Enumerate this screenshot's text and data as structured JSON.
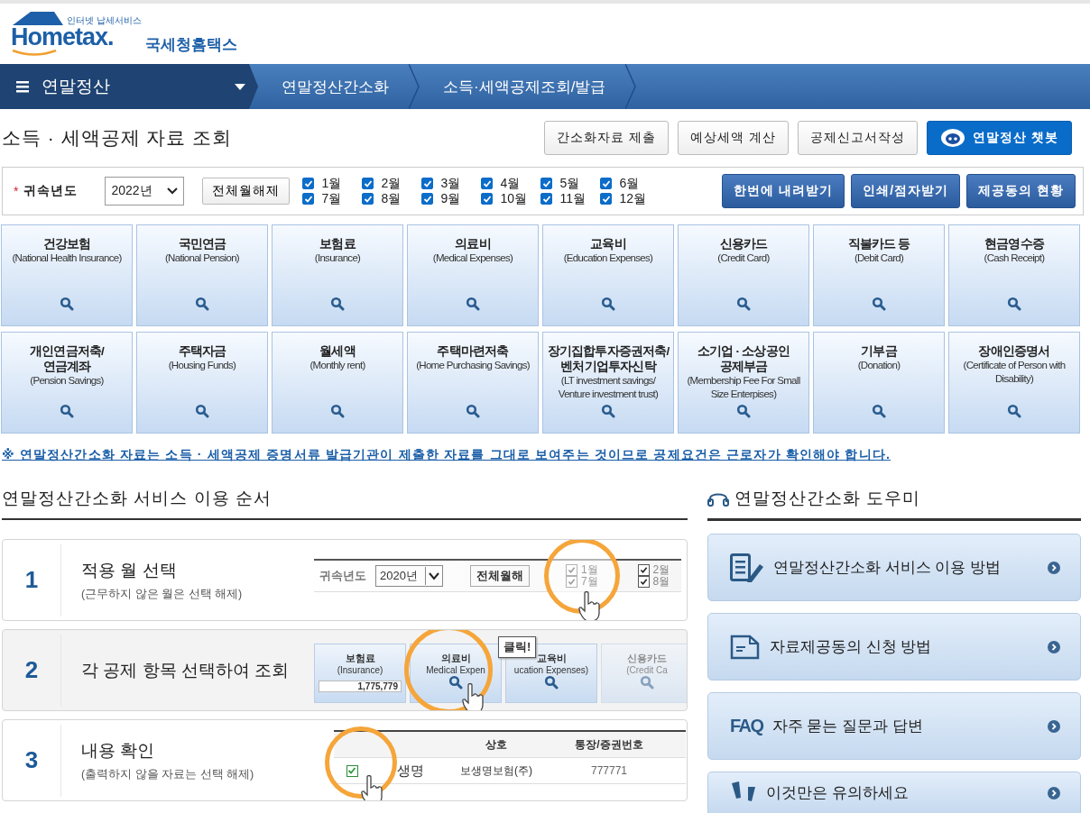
{
  "header": {
    "logo_tagline": "인터넷 납세서비스",
    "logo_word": "Hometax.",
    "logo_name": "국세청홈택스"
  },
  "nav": {
    "menu": "연말정산",
    "breadcrumbs": [
      "연말정산간소화",
      "소득·세액공제조회/발급"
    ]
  },
  "page_title": "소득 · 세액공제 자료 조회",
  "actions": [
    {
      "label": "간소화자료 제출",
      "kind": "plain"
    },
    {
      "label": "예상세액 계산",
      "kind": "plain"
    },
    {
      "label": "공제신고서작성",
      "kind": "plain"
    },
    {
      "label": "연말정산 챗봇",
      "kind": "chatbot"
    }
  ],
  "filter": {
    "required_mark": "*",
    "label": "귀속년도",
    "year": "2022년",
    "clear_button": "전체월해제",
    "months": [
      {
        "label": "1월",
        "checked": true
      },
      {
        "label": "2월",
        "checked": true
      },
      {
        "label": "3월",
        "checked": true
      },
      {
        "label": "4월",
        "checked": true
      },
      {
        "label": "5월",
        "checked": true
      },
      {
        "label": "6월",
        "checked": true
      },
      {
        "label": "7월",
        "checked": true
      },
      {
        "label": "8월",
        "checked": true
      },
      {
        "label": "9월",
        "checked": true
      },
      {
        "label": "10월",
        "checked": true
      },
      {
        "label": "11월",
        "checked": true
      },
      {
        "label": "12월",
        "checked": true
      }
    ],
    "buttons": [
      "한번에 내려받기",
      "인쇄/점자받기",
      "제공동의 현황"
    ]
  },
  "categories": [
    {
      "title": "건강보험",
      "subtitle": "(National Health Insurance)"
    },
    {
      "title": "국민연금",
      "subtitle": "(National Pension)"
    },
    {
      "title": "보험료",
      "subtitle": "(Insurance)"
    },
    {
      "title": "의료비",
      "subtitle": "(Medical Expenses)"
    },
    {
      "title": "교육비",
      "subtitle": "(Education Expenses)"
    },
    {
      "title": "신용카드",
      "subtitle": "(Credit Card)"
    },
    {
      "title": "직불카드 등",
      "subtitle": "(Debit Card)"
    },
    {
      "title": "현금영수증",
      "subtitle": "(Cash Receipt)"
    },
    {
      "title": "개인연금저축/\n연금계좌",
      "subtitle": "(Pension Savings)"
    },
    {
      "title": "주택자금",
      "subtitle": "(Housing Funds)"
    },
    {
      "title": "월세액",
      "subtitle": "(Monthly rent)"
    },
    {
      "title": "주택마련저축",
      "subtitle": "(Home Purchasing Savings)"
    },
    {
      "title": "장기집합투자증권저축/\n벤처기업투자신탁",
      "subtitle": "(LT investment savings/ Venture investment trust)"
    },
    {
      "title": "소기업 · 소상공인\n공제부금",
      "subtitle": "(Membership Fee For Small Size Enterpises)"
    },
    {
      "title": "기부금",
      "subtitle": "(Donation)"
    },
    {
      "title": "장애인증명서",
      "subtitle": "(Certificate of Person with Disability)"
    }
  ],
  "notice": "※ 연말정산간소화 자료는 소득 · 세액공제 증명서류 발급기관이 제출한 자료를 그대로 보여주는 것이므로 공제요건은 근로자가 확인해야 합니다.",
  "steps_section": {
    "title": "연말정산간소화 서비스 이용 순서",
    "steps": [
      {
        "number": "1",
        "title": "적용 월 선택",
        "note": "(근무하지 않은 월은 선택 해제)",
        "kind": "months",
        "illustration": {
          "label": "귀속년도",
          "year": "2020년",
          "button": "전체월해",
          "months": [
            "1월",
            "7월",
            "2월",
            "8월"
          ]
        }
      },
      {
        "number": "2",
        "title": "각 공제 항목 선택하여 조회",
        "kind": "tiles",
        "illustration": {
          "tiles": [
            {
              "title": "보험료",
              "subtitle": "(Insurance)",
              "value": "1,775,779"
            },
            {
              "title": "의료비",
              "subtitle": "Medical Expen"
            },
            {
              "title": "교육비",
              "subtitle": "ucation Expenses)"
            },
            {
              "title": "신용카드",
              "subtitle": "(Credit Ca"
            }
          ],
          "callout": "클릭!"
        }
      },
      {
        "number": "3",
        "title": "내용 확인",
        "note": "(출력하지 않을 자료는 선택 해제)",
        "kind": "table",
        "illustration": {
          "columns": [
            "상호",
            "통장/증권번호"
          ],
          "row": {
            "checked": true,
            "zoom_text": "생명",
            "name": "보생명보험(주)",
            "account": "777771"
          }
        }
      }
    ]
  },
  "helper": {
    "title": "연말정산간소화 도우미",
    "links": [
      {
        "label": "연말정산간소화 서비스 이용 방법",
        "kind": "guide"
      },
      {
        "label": "자료제공동의 신청 방법",
        "kind": "form"
      },
      {
        "label": "자주 묻는 질문과 답변",
        "kind": "faq",
        "badge": "FAQ"
      },
      {
        "label": "이것만은 유의하세요",
        "kind": "warning"
      }
    ]
  }
}
